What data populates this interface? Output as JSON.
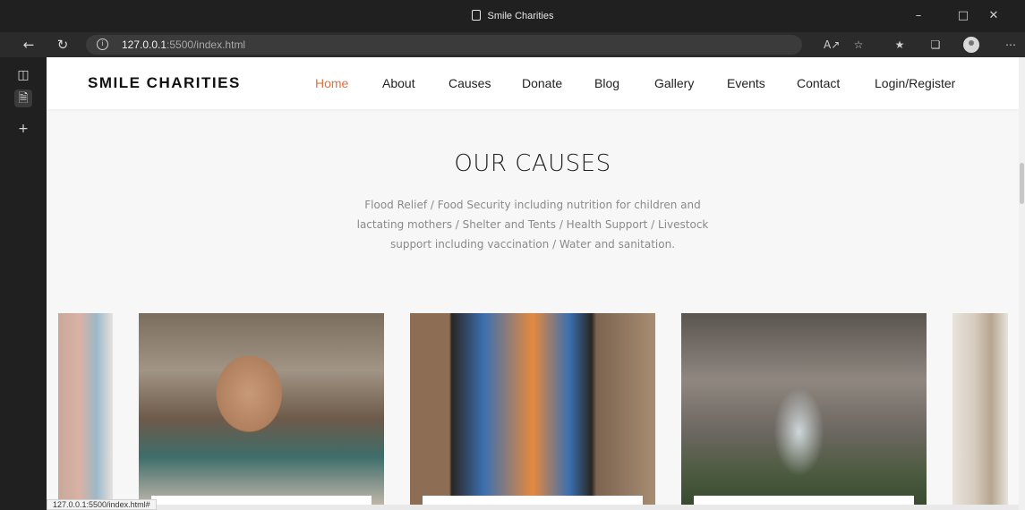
{
  "browser": {
    "tab_title": "Smile Charities",
    "url_host": "127.0.0.1",
    "url_rest": ":5500/index.html",
    "status_url": "127.0.0.1:5500/index.html#"
  },
  "site": {
    "brand": "SMILE CHARITIES",
    "nav": [
      {
        "label": "Home",
        "active": true
      },
      {
        "label": "About"
      },
      {
        "label": "Causes"
      },
      {
        "label": "Donate"
      },
      {
        "label": "Blog"
      },
      {
        "label": "Gallery"
      },
      {
        "label": "Events"
      },
      {
        "label": "Contact"
      },
      {
        "label": "Login/Register"
      }
    ],
    "accent_color": "#e2703a"
  },
  "causes": {
    "title": "OUR CAUSES",
    "description_lines": [
      "Flood Relief / Food Security including nutrition for children and",
      "lactating mothers / Shelter and Tents / Health Support / Livestock",
      "support including vaccination / Water and sanitation."
    ]
  }
}
